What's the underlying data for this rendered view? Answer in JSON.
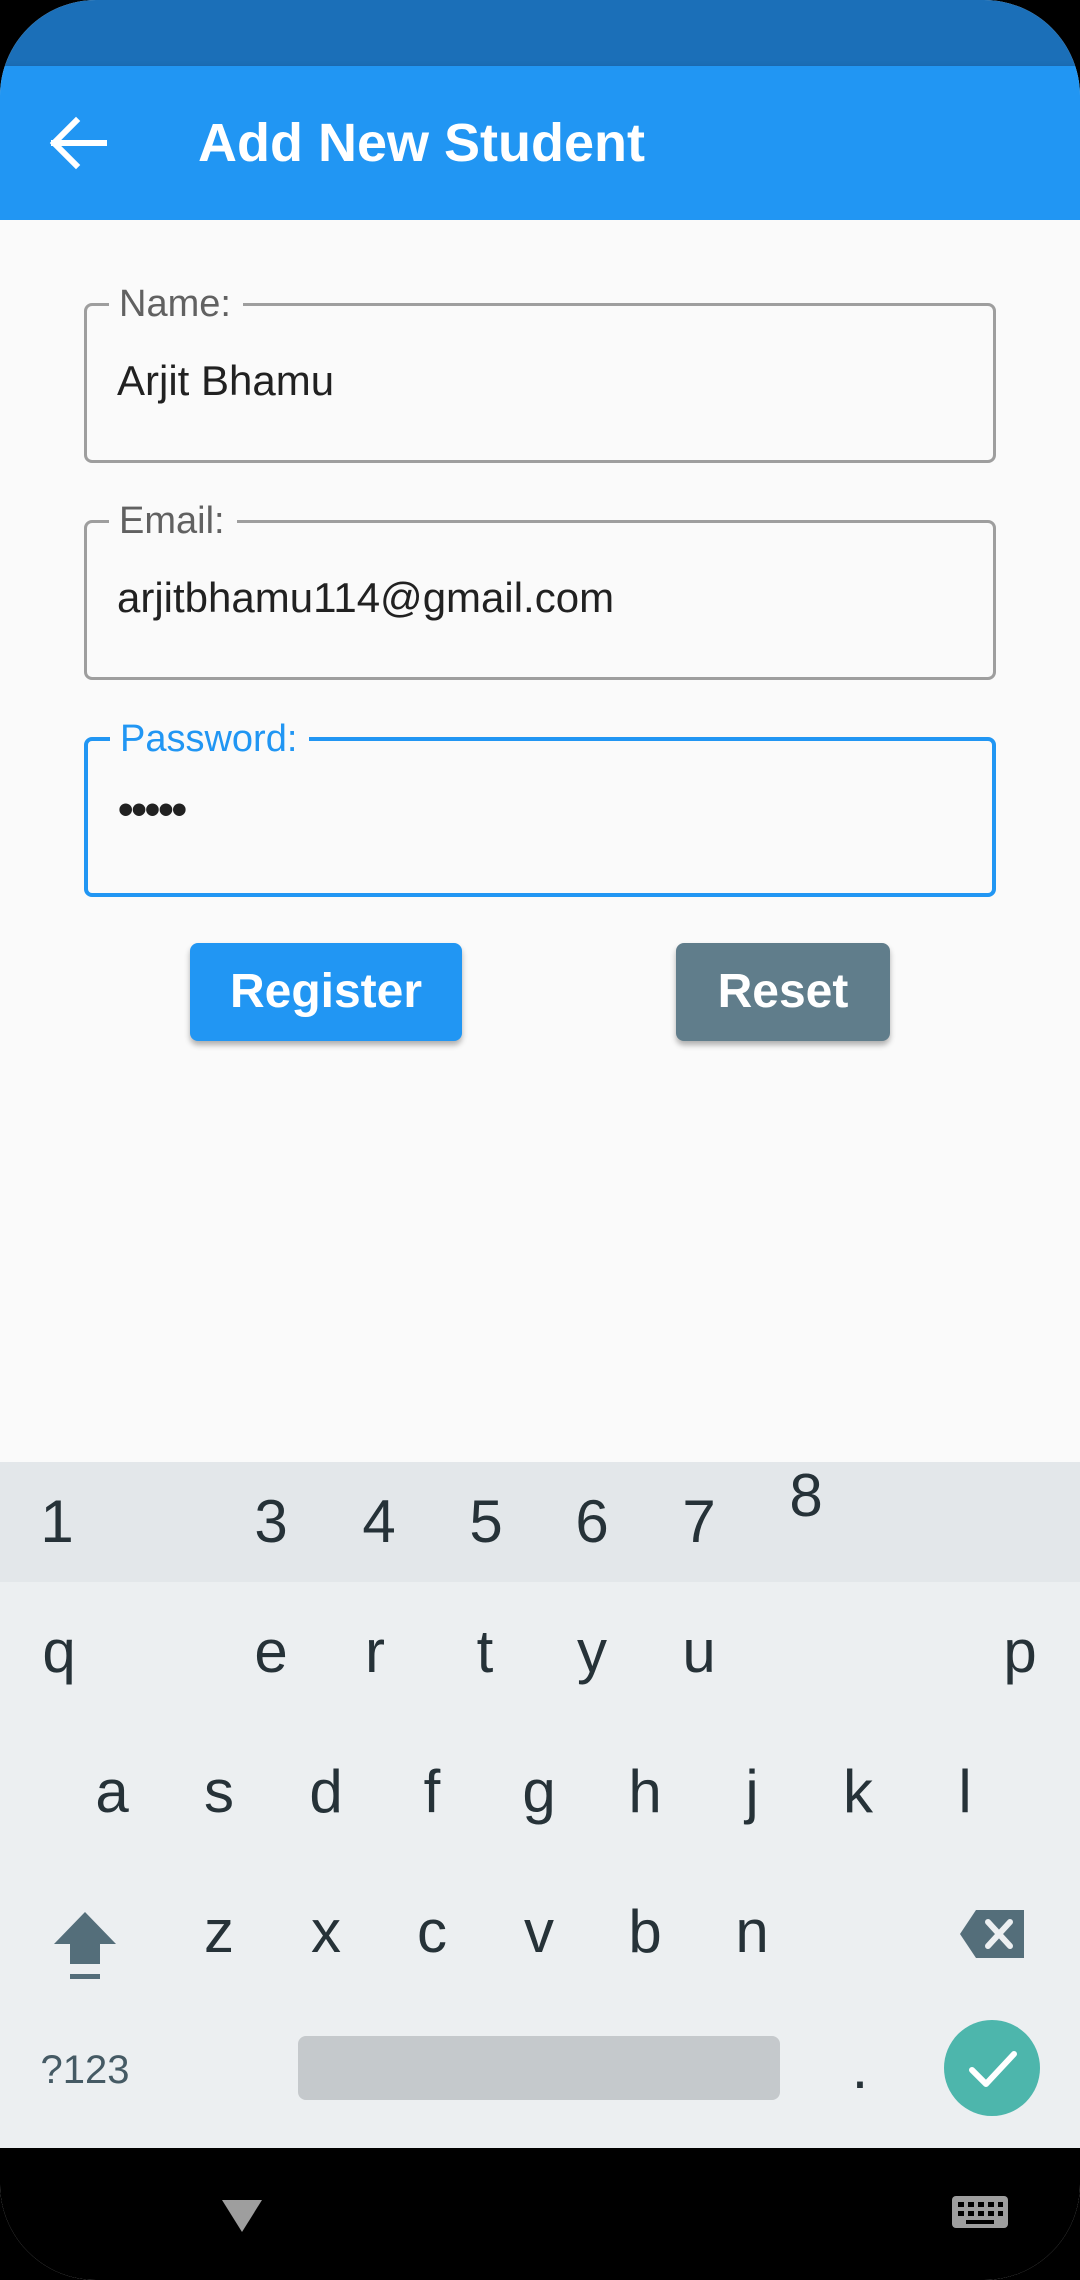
{
  "app_bar": {
    "title": "Add New Student",
    "color": "#2196f3"
  },
  "form": {
    "name": {
      "label": "Name:",
      "value": "Arjit Bhamu"
    },
    "email": {
      "label": "Email:",
      "value": "arjitbhamu114@gmail.com"
    },
    "password": {
      "label": "Password:",
      "value": "•••••",
      "focused_color": "#2196f3"
    }
  },
  "buttons": {
    "register": {
      "label": "Register",
      "color": "#2196f3"
    },
    "reset": {
      "label": "Reset",
      "color": "#607d8b"
    }
  },
  "keyboard": {
    "number_row": [
      "1",
      "3",
      "4",
      "5",
      "6",
      "7",
      "8"
    ],
    "row1": [
      "q",
      "e",
      "r",
      "t",
      "y",
      "u",
      "p"
    ],
    "row2": [
      "a",
      "s",
      "d",
      "f",
      "g",
      "h",
      "j",
      "k",
      "l"
    ],
    "row3": [
      "z",
      "x",
      "c",
      "v",
      "b",
      "n"
    ],
    "symbols_label": "?123",
    "period_label": ".",
    "icons": {
      "shift": "shift-arrow-icon",
      "backspace": "backspace-icon",
      "enter": "checkmark-icon",
      "hide_keyboard": "keyboard-icon",
      "nav_back": "triangle-down-icon"
    }
  }
}
